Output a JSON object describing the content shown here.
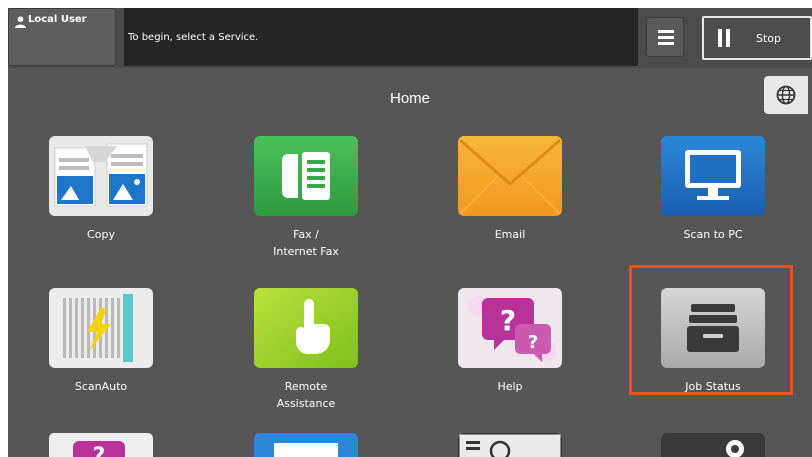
{
  "header": {
    "user_label": "Local User",
    "message": "To begin, select a Service.",
    "stop_label": "Stop"
  },
  "home": {
    "title": "Home"
  },
  "apps": [
    {
      "label": "Copy",
      "icon": "copy-icon"
    },
    {
      "label": "Fax /\nInternet Fax",
      "icon": "fax-icon"
    },
    {
      "label": "Email",
      "icon": "email-icon"
    },
    {
      "label": "Scan to PC",
      "icon": "scan-to-pc-icon"
    },
    {
      "label": "ScanAuto",
      "icon": "scan-auto-icon"
    },
    {
      "label": "Remote\nAssistance",
      "icon": "remote-assistance-icon"
    },
    {
      "label": "Help",
      "icon": "help-icon"
    },
    {
      "label": "Job Status",
      "icon": "job-status-icon"
    }
  ],
  "colors": {
    "screen_bg": "#565656",
    "message_bg": "#262626",
    "highlight": "#e8541c",
    "fax_green": "#3aa84a",
    "email_orange": "#f4a62a",
    "scan_pc_blue": "#1f6fc2"
  }
}
